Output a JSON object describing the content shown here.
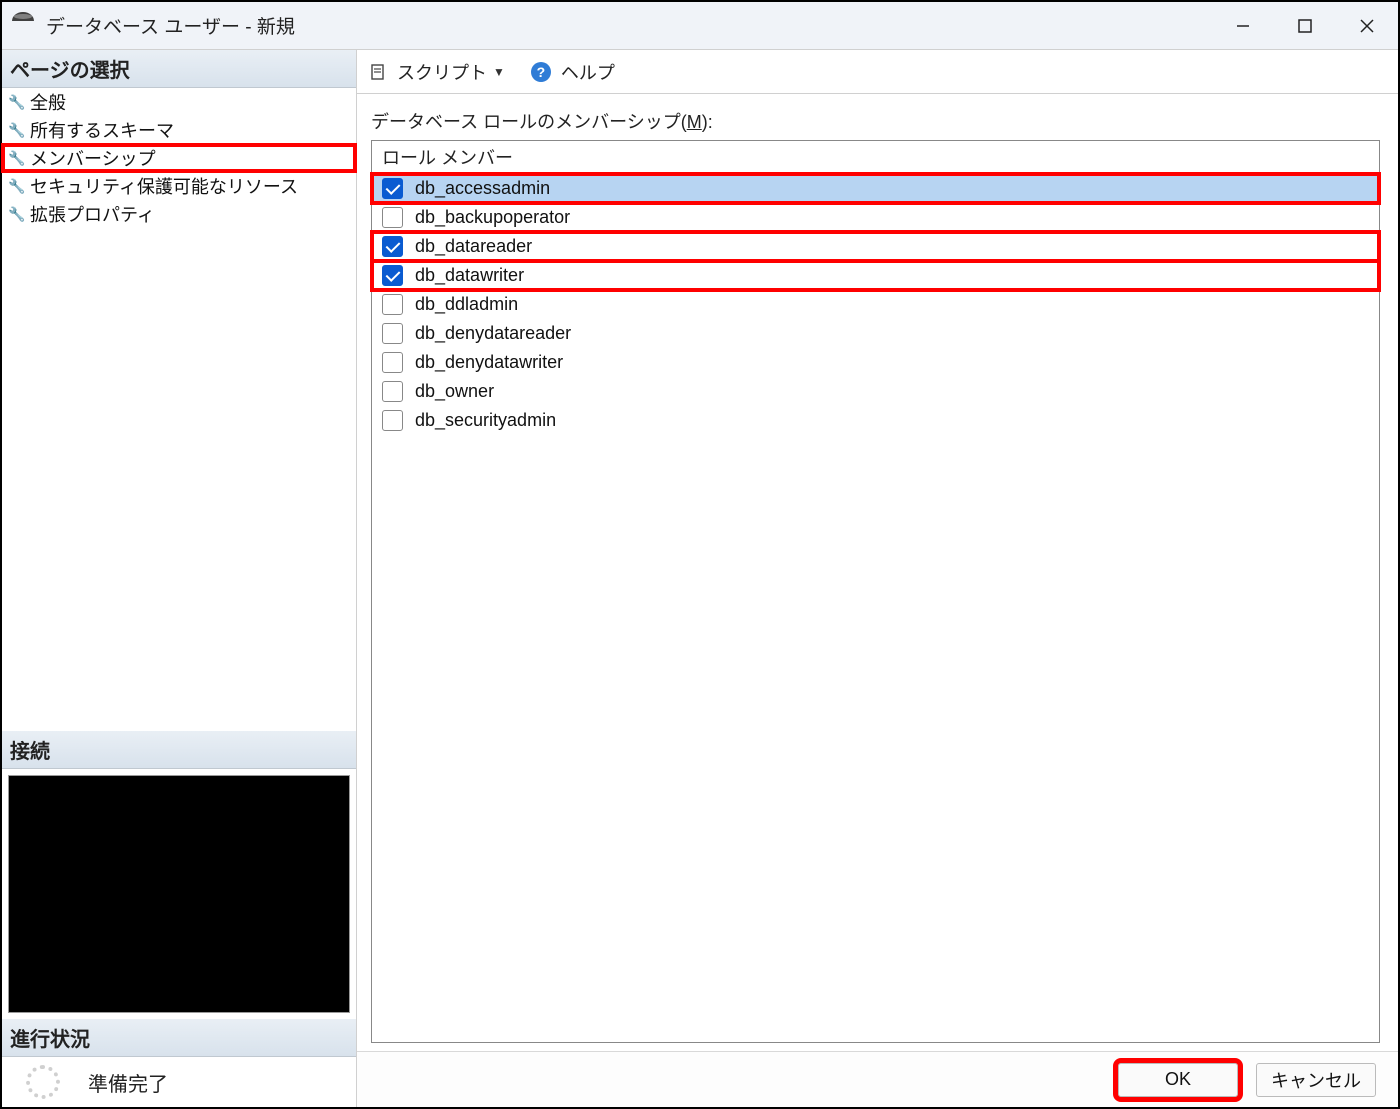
{
  "window_title": "データベース ユーザー - 新規",
  "sidebar": {
    "page_select_header": "ページの選択",
    "items": [
      {
        "label": "全般"
      },
      {
        "label": "所有するスキーマ"
      },
      {
        "label": "メンバーシップ",
        "highlighted": true
      },
      {
        "label": "セキュリティ保護可能なリソース"
      },
      {
        "label": "拡張プロパティ"
      }
    ],
    "connection_header": "接続",
    "progress_header": "進行状況",
    "progress_status": "準備完了"
  },
  "toolbar": {
    "script_label": "スクリプト",
    "help_label": "ヘルプ"
  },
  "content": {
    "label_prefix": "データベース ロールのメンバーシップ(",
    "label_mnemonic": "M",
    "label_suffix": "):",
    "column_header": "ロール メンバー",
    "roles": [
      {
        "name": "db_accessadmin",
        "checked": true,
        "selected": true,
        "highlighted": true
      },
      {
        "name": "db_backupoperator",
        "checked": false,
        "selected": false,
        "highlighted": false
      },
      {
        "name": "db_datareader",
        "checked": true,
        "selected": false,
        "highlighted": true
      },
      {
        "name": "db_datawriter",
        "checked": true,
        "selected": false,
        "highlighted": true
      },
      {
        "name": "db_ddladmin",
        "checked": false,
        "selected": false,
        "highlighted": false
      },
      {
        "name": "db_denydatareader",
        "checked": false,
        "selected": false,
        "highlighted": false
      },
      {
        "name": "db_denydatawriter",
        "checked": false,
        "selected": false,
        "highlighted": false
      },
      {
        "name": "db_owner",
        "checked": false,
        "selected": false,
        "highlighted": false
      },
      {
        "name": "db_securityadmin",
        "checked": false,
        "selected": false,
        "highlighted": false
      }
    ]
  },
  "footer": {
    "ok": "OK",
    "cancel": "キャンセル"
  }
}
